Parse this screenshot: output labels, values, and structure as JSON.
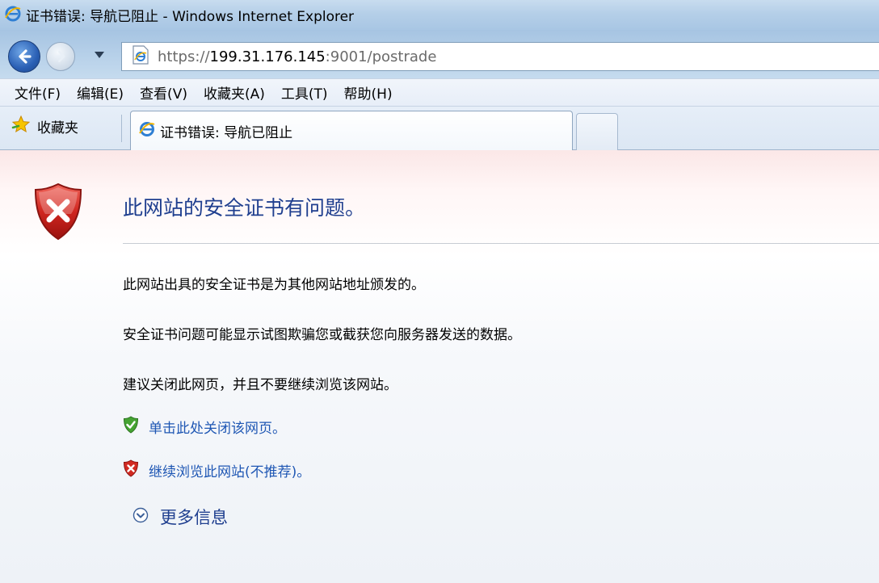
{
  "window": {
    "title": "证书错误: 导航已阻止 - Windows Internet Explorer"
  },
  "address": {
    "url_scheme": "https://",
    "url_host": "199.31.176.145",
    "url_rest": ":9001/postrade"
  },
  "menu": {
    "items": [
      {
        "label": "文件(F)"
      },
      {
        "label": "编辑(E)"
      },
      {
        "label": "查看(V)"
      },
      {
        "label": "收藏夹(A)"
      },
      {
        "label": "工具(T)"
      },
      {
        "label": "帮助(H)"
      }
    ]
  },
  "favorites": {
    "label": "收藏夹"
  },
  "tab": {
    "title": "证书错误: 导航已阻止"
  },
  "page": {
    "heading": "此网站的安全证书有问题。",
    "paragraphs": [
      "此网站出具的安全证书是为其他网站地址颁发的。",
      "安全证书问题可能显示试图欺骗您或截获您向服务器发送的数据。",
      "建议关闭此网页，并且不要继续浏览该网站。"
    ],
    "close_link": "单击此处关闭该网页。",
    "continue_link": "继续浏览此网站(不推荐)。",
    "more_info": "更多信息"
  },
  "icons": {
    "window_icon": "ie-icon",
    "back": "back-arrow-icon",
    "forward": "forward-arrow-icon",
    "page": "ie-page-icon",
    "favorites": "star-icon",
    "error": "red-shield-x-icon",
    "close_link": "green-shield-check-icon",
    "continue_link": "red-shield-x-icon",
    "more_info": "chevron-down-circle-icon"
  },
  "colors": {
    "heading": "#1f3f8f",
    "link": "#1f57b4",
    "error_red": "#c8201c",
    "safe_green": "#3f9a2b"
  }
}
